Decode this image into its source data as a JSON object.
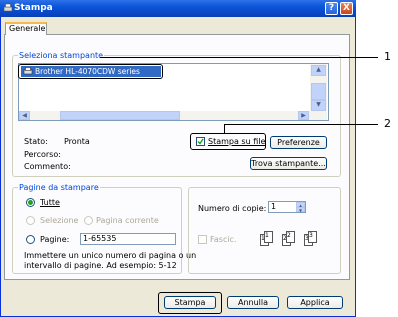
{
  "window": {
    "title": "Stampa",
    "help_glyph": "?",
    "close_glyph": "X"
  },
  "tabs": [
    {
      "label": "Generale"
    }
  ],
  "printer_section": {
    "label": "Seleziona stampante",
    "selected_printer": "Brother HL-4070CDW series",
    "status_label": "Stato:",
    "status_value": "Pronta",
    "location_label": "Percorso:",
    "comment_label": "Commento:",
    "print_to_file_label": "Stampa su file",
    "print_to_file_checked": true,
    "preferences_button": "Preferenze",
    "find_printer_button": "Trova stampante..."
  },
  "page_range": {
    "label": "Pagine da stampare",
    "all_label": "Tutte",
    "selection_label": "Selezione",
    "current_page_label": "Pagina corrente",
    "pages_label": "Pagine:",
    "pages_value": "1-65535",
    "help_text_1": "Immettere un unico numero di pagina o un",
    "help_text_2": "intervallo di pagine. Ad esempio: 5-12"
  },
  "copies": {
    "label": "Numero di copie:",
    "value": "1",
    "collate_label": "Fascic.",
    "collate_checked": false,
    "page_icons": [
      "1",
      "1",
      "2",
      "2",
      "3",
      "3"
    ]
  },
  "buttons": {
    "print": "Stampa",
    "cancel": "Annulla",
    "apply": "Applica"
  },
  "callouts": [
    "1",
    "2"
  ]
}
